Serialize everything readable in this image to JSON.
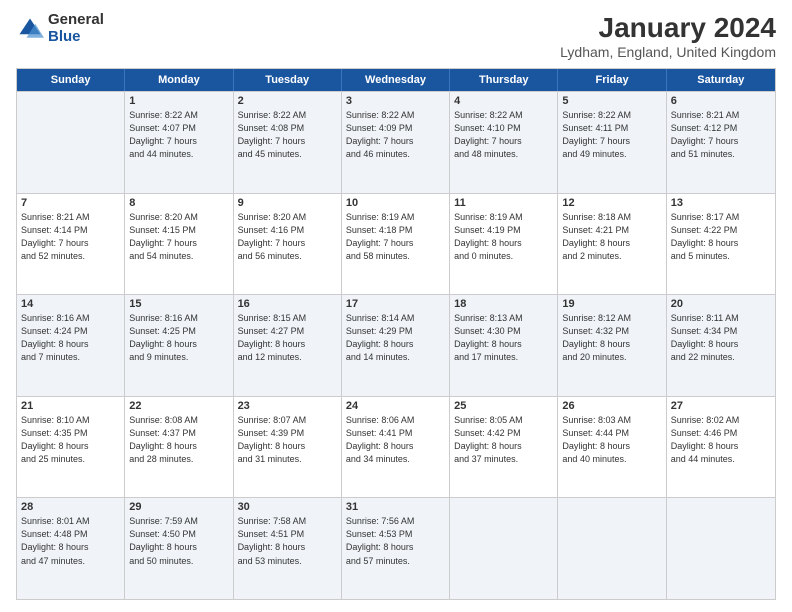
{
  "logo": {
    "general": "General",
    "blue": "Blue"
  },
  "title": "January 2024",
  "location": "Lydham, England, United Kingdom",
  "days": [
    "Sunday",
    "Monday",
    "Tuesday",
    "Wednesday",
    "Thursday",
    "Friday",
    "Saturday"
  ],
  "rows": [
    [
      {
        "day": "",
        "lines": []
      },
      {
        "day": "1",
        "lines": [
          "Sunrise: 8:22 AM",
          "Sunset: 4:07 PM",
          "Daylight: 7 hours",
          "and 44 minutes."
        ]
      },
      {
        "day": "2",
        "lines": [
          "Sunrise: 8:22 AM",
          "Sunset: 4:08 PM",
          "Daylight: 7 hours",
          "and 45 minutes."
        ]
      },
      {
        "day": "3",
        "lines": [
          "Sunrise: 8:22 AM",
          "Sunset: 4:09 PM",
          "Daylight: 7 hours",
          "and 46 minutes."
        ]
      },
      {
        "day": "4",
        "lines": [
          "Sunrise: 8:22 AM",
          "Sunset: 4:10 PM",
          "Daylight: 7 hours",
          "and 48 minutes."
        ]
      },
      {
        "day": "5",
        "lines": [
          "Sunrise: 8:22 AM",
          "Sunset: 4:11 PM",
          "Daylight: 7 hours",
          "and 49 minutes."
        ]
      },
      {
        "day": "6",
        "lines": [
          "Sunrise: 8:21 AM",
          "Sunset: 4:12 PM",
          "Daylight: 7 hours",
          "and 51 minutes."
        ]
      }
    ],
    [
      {
        "day": "7",
        "lines": [
          "Sunrise: 8:21 AM",
          "Sunset: 4:14 PM",
          "Daylight: 7 hours",
          "and 52 minutes."
        ]
      },
      {
        "day": "8",
        "lines": [
          "Sunrise: 8:20 AM",
          "Sunset: 4:15 PM",
          "Daylight: 7 hours",
          "and 54 minutes."
        ]
      },
      {
        "day": "9",
        "lines": [
          "Sunrise: 8:20 AM",
          "Sunset: 4:16 PM",
          "Daylight: 7 hours",
          "and 56 minutes."
        ]
      },
      {
        "day": "10",
        "lines": [
          "Sunrise: 8:19 AM",
          "Sunset: 4:18 PM",
          "Daylight: 7 hours",
          "and 58 minutes."
        ]
      },
      {
        "day": "11",
        "lines": [
          "Sunrise: 8:19 AM",
          "Sunset: 4:19 PM",
          "Daylight: 8 hours",
          "and 0 minutes."
        ]
      },
      {
        "day": "12",
        "lines": [
          "Sunrise: 8:18 AM",
          "Sunset: 4:21 PM",
          "Daylight: 8 hours",
          "and 2 minutes."
        ]
      },
      {
        "day": "13",
        "lines": [
          "Sunrise: 8:17 AM",
          "Sunset: 4:22 PM",
          "Daylight: 8 hours",
          "and 5 minutes."
        ]
      }
    ],
    [
      {
        "day": "14",
        "lines": [
          "Sunrise: 8:16 AM",
          "Sunset: 4:24 PM",
          "Daylight: 8 hours",
          "and 7 minutes."
        ]
      },
      {
        "day": "15",
        "lines": [
          "Sunrise: 8:16 AM",
          "Sunset: 4:25 PM",
          "Daylight: 8 hours",
          "and 9 minutes."
        ]
      },
      {
        "day": "16",
        "lines": [
          "Sunrise: 8:15 AM",
          "Sunset: 4:27 PM",
          "Daylight: 8 hours",
          "and 12 minutes."
        ]
      },
      {
        "day": "17",
        "lines": [
          "Sunrise: 8:14 AM",
          "Sunset: 4:29 PM",
          "Daylight: 8 hours",
          "and 14 minutes."
        ]
      },
      {
        "day": "18",
        "lines": [
          "Sunrise: 8:13 AM",
          "Sunset: 4:30 PM",
          "Daylight: 8 hours",
          "and 17 minutes."
        ]
      },
      {
        "day": "19",
        "lines": [
          "Sunrise: 8:12 AM",
          "Sunset: 4:32 PM",
          "Daylight: 8 hours",
          "and 20 minutes."
        ]
      },
      {
        "day": "20",
        "lines": [
          "Sunrise: 8:11 AM",
          "Sunset: 4:34 PM",
          "Daylight: 8 hours",
          "and 22 minutes."
        ]
      }
    ],
    [
      {
        "day": "21",
        "lines": [
          "Sunrise: 8:10 AM",
          "Sunset: 4:35 PM",
          "Daylight: 8 hours",
          "and 25 minutes."
        ]
      },
      {
        "day": "22",
        "lines": [
          "Sunrise: 8:08 AM",
          "Sunset: 4:37 PM",
          "Daylight: 8 hours",
          "and 28 minutes."
        ]
      },
      {
        "day": "23",
        "lines": [
          "Sunrise: 8:07 AM",
          "Sunset: 4:39 PM",
          "Daylight: 8 hours",
          "and 31 minutes."
        ]
      },
      {
        "day": "24",
        "lines": [
          "Sunrise: 8:06 AM",
          "Sunset: 4:41 PM",
          "Daylight: 8 hours",
          "and 34 minutes."
        ]
      },
      {
        "day": "25",
        "lines": [
          "Sunrise: 8:05 AM",
          "Sunset: 4:42 PM",
          "Daylight: 8 hours",
          "and 37 minutes."
        ]
      },
      {
        "day": "26",
        "lines": [
          "Sunrise: 8:03 AM",
          "Sunset: 4:44 PM",
          "Daylight: 8 hours",
          "and 40 minutes."
        ]
      },
      {
        "day": "27",
        "lines": [
          "Sunrise: 8:02 AM",
          "Sunset: 4:46 PM",
          "Daylight: 8 hours",
          "and 44 minutes."
        ]
      }
    ],
    [
      {
        "day": "28",
        "lines": [
          "Sunrise: 8:01 AM",
          "Sunset: 4:48 PM",
          "Daylight: 8 hours",
          "and 47 minutes."
        ]
      },
      {
        "day": "29",
        "lines": [
          "Sunrise: 7:59 AM",
          "Sunset: 4:50 PM",
          "Daylight: 8 hours",
          "and 50 minutes."
        ]
      },
      {
        "day": "30",
        "lines": [
          "Sunrise: 7:58 AM",
          "Sunset: 4:51 PM",
          "Daylight: 8 hours",
          "and 53 minutes."
        ]
      },
      {
        "day": "31",
        "lines": [
          "Sunrise: 7:56 AM",
          "Sunset: 4:53 PM",
          "Daylight: 8 hours",
          "and 57 minutes."
        ]
      },
      {
        "day": "",
        "lines": []
      },
      {
        "day": "",
        "lines": []
      },
      {
        "day": "",
        "lines": []
      }
    ]
  ],
  "alt_rows": [
    0,
    2,
    4
  ]
}
